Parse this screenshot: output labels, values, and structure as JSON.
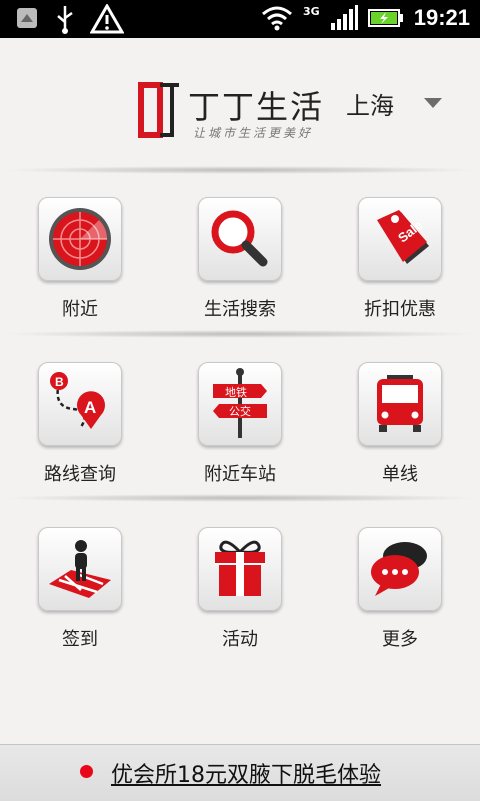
{
  "status_bar": {
    "time": "19:21",
    "network": "3G",
    "icons": [
      "satellite-icon",
      "usb-icon",
      "warning-icon",
      "wifi-icon",
      "signal-icon",
      "battery-charging-icon"
    ]
  },
  "header": {
    "brand_name": "丁丁生活",
    "slogan": "让城市生活更美好",
    "city": "上海",
    "brand_color": "#d5151f"
  },
  "menu": [
    {
      "label": "附近",
      "icon": "radar-icon"
    },
    {
      "label": "生活搜索",
      "icon": "magnifier-icon"
    },
    {
      "label": "折扣优惠",
      "icon": "sale-tag-icon"
    },
    {
      "label": "路线查询",
      "icon": "route-icon"
    },
    {
      "label": "附近车站",
      "icon": "signpost-icon",
      "sign_top": "地铁",
      "sign_bottom": "公交"
    },
    {
      "label": "单线",
      "icon": "bus-icon"
    },
    {
      "label": "签到",
      "icon": "checkin-icon"
    },
    {
      "label": "活动",
      "icon": "gift-icon"
    },
    {
      "label": "更多",
      "icon": "chat-bubbles-icon"
    }
  ],
  "banner": {
    "text": "优会所18元双腋下脱毛体验",
    "dot_color": "#e8081a"
  }
}
